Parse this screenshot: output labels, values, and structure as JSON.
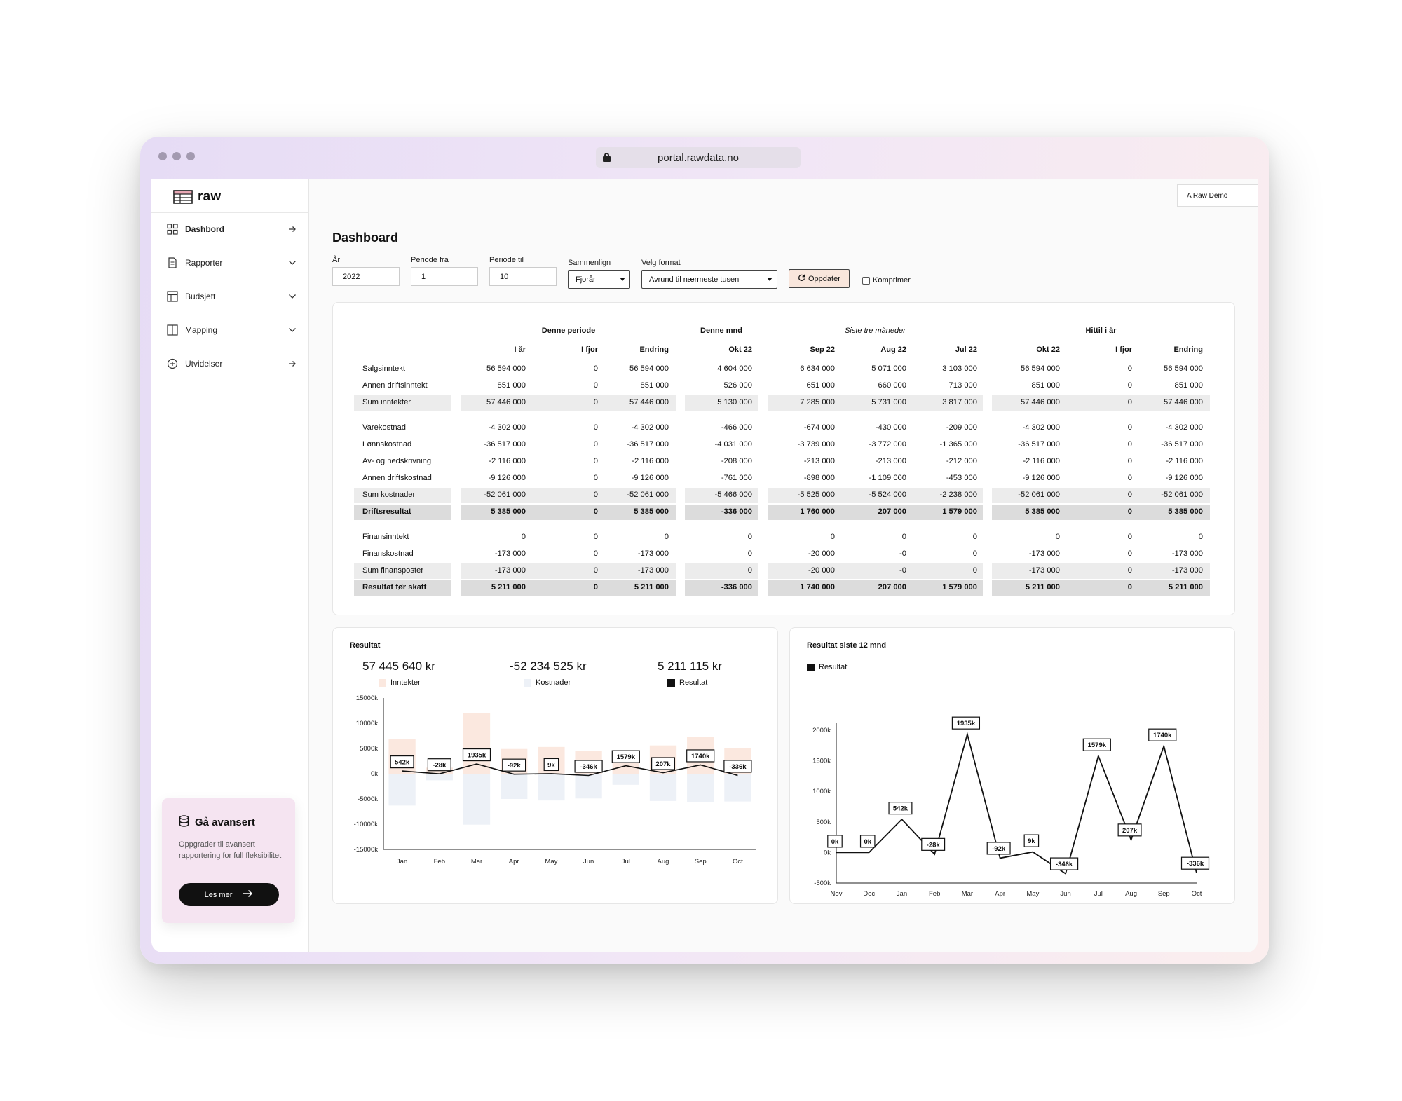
{
  "browser": {
    "url": "portal.rawdata.no"
  },
  "sidebar": {
    "logo": "raw",
    "items": [
      {
        "label": "Dashbord",
        "arrow": "right",
        "active": true
      },
      {
        "label": "Rapporter",
        "arrow": "down"
      },
      {
        "label": "Budsjett",
        "arrow": "down"
      },
      {
        "label": "Mapping",
        "arrow": "down"
      },
      {
        "label": "Utvidelser",
        "arrow": "right"
      }
    ],
    "promo": {
      "title": "Gå avansert",
      "text": "Oppgrader til avansert rapportering for full fleksibilitet",
      "button": "Les mer"
    }
  },
  "header": {
    "user": "A Raw Demo"
  },
  "page": {
    "title": "Dashboard"
  },
  "filters": {
    "year_label": "År",
    "year": "2022",
    "from_label": "Periode fra",
    "from": "1",
    "to_label": "Periode til",
    "to": "10",
    "compare_label": "Sammenlign",
    "compare": "Fjorår",
    "format_label": "Velg format",
    "format": "Avrund til nærmeste tusen",
    "update": "Oppdater",
    "compress": "Komprimer"
  },
  "table": {
    "groups": [
      "Denne periode",
      "Denne mnd",
      "Siste tre måneder",
      "Hittil i år"
    ],
    "columns": [
      "I år",
      "I fjor",
      "Endring",
      "Okt 22",
      "Sep 22",
      "Aug 22",
      "Jul 22",
      "Okt 22",
      "I fjor",
      "Endring"
    ],
    "rows": [
      {
        "label": "Salgsinntekt",
        "values": [
          "56 594 000",
          "0",
          "56 594 000",
          "4 604 000",
          "6 634 000",
          "5 071 000",
          "3 103 000",
          "56 594 000",
          "0",
          "56 594 000"
        ]
      },
      {
        "label": "Annen driftsinntekt",
        "values": [
          "851 000",
          "0",
          "851 000",
          "526 000",
          "651 000",
          "660 000",
          "713 000",
          "851 000",
          "0",
          "851 000"
        ]
      },
      {
        "label": "Sum inntekter",
        "values": [
          "57 446 000",
          "0",
          "57 446 000",
          "5 130 000",
          "7 285 000",
          "5 731 000",
          "3 817 000",
          "57 446 000",
          "0",
          "57 446 000"
        ]
      },
      {
        "label": "Varekostnad",
        "values": [
          "-4 302 000",
          "0",
          "-4 302 000",
          "-466 000",
          "-674 000",
          "-430 000",
          "-209 000",
          "-4 302 000",
          "0",
          "-4 302 000"
        ]
      },
      {
        "label": "Lønnskostnad",
        "values": [
          "-36 517 000",
          "0",
          "-36 517 000",
          "-4 031 000",
          "-3 739 000",
          "-3 772 000",
          "-1 365 000",
          "-36 517 000",
          "0",
          "-36 517 000"
        ]
      },
      {
        "label": "Av- og nedskrivning",
        "values": [
          "-2 116 000",
          "0",
          "-2 116 000",
          "-208 000",
          "-213 000",
          "-213 000",
          "-212 000",
          "-2 116 000",
          "0",
          "-2 116 000"
        ]
      },
      {
        "label": "Annen driftskostnad",
        "values": [
          "-9 126 000",
          "0",
          "-9 126 000",
          "-761 000",
          "-898 000",
          "-1 109 000",
          "-453 000",
          "-9 126 000",
          "0",
          "-9 126 000"
        ]
      },
      {
        "label": "Sum kostnader",
        "values": [
          "-52 061 000",
          "0",
          "-52 061 000",
          "-5 466 000",
          "-5 525 000",
          "-5 524 000",
          "-2 238 000",
          "-52 061 000",
          "0",
          "-52 061 000"
        ]
      },
      {
        "label": "Driftsresultat",
        "values": [
          "5 385 000",
          "0",
          "5 385 000",
          "-336 000",
          "1 760 000",
          "207 000",
          "1 579 000",
          "5 385 000",
          "0",
          "5 385 000"
        ]
      },
      {
        "label": "Finansinntekt",
        "values": [
          "0",
          "0",
          "0",
          "0",
          "0",
          "0",
          "0",
          "0",
          "0",
          "0"
        ]
      },
      {
        "label": "Finanskostnad",
        "values": [
          "-173 000",
          "0",
          "-173 000",
          "0",
          "-20 000",
          "-0",
          "0",
          "-173 000",
          "0",
          "-173 000"
        ]
      },
      {
        "label": "Sum finansposter",
        "values": [
          "-173 000",
          "0",
          "-173 000",
          "0",
          "-20 000",
          "-0",
          "0",
          "-173 000",
          "0",
          "-173 000"
        ]
      },
      {
        "label": "Resultat før skatt",
        "values": [
          "5 211 000",
          "0",
          "5 211 000",
          "-336 000",
          "1 740 000",
          "207 000",
          "1 579 000",
          "5 211 000",
          "0",
          "5 211 000"
        ]
      }
    ]
  },
  "kpis": {
    "income": "57 445 640 kr",
    "income_label": "Inntekter",
    "costs": "-52 234 525 kr",
    "costs_label": "Kostnader",
    "result": "5 211 115 kr",
    "result_label": "Resultat"
  },
  "colors": {
    "income": "#fbe8df",
    "costs": "#edf1f7",
    "result": "#111111"
  },
  "chart_data": [
    {
      "type": "bar",
      "title": "Resultat",
      "categories": [
        "Jan",
        "Feb",
        "Mar",
        "Apr",
        "May",
        "Jun",
        "Jul",
        "Aug",
        "Sep",
        "Oct"
      ],
      "ylim": [
        -15000,
        15000
      ],
      "yticks": [
        15000,
        10000,
        5000,
        0,
        -5000,
        -10000,
        -15000
      ],
      "ytick_labels": [
        "15000k",
        "10000k",
        "5000k",
        "0k",
        "-5000k",
        "-10000k",
        "-15000k"
      ],
      "series": [
        {
          "name": "Inntekter",
          "type": "bar",
          "values": [
            6800,
            1200,
            12000,
            4900,
            5300,
            4500,
            3800,
            5600,
            7300,
            5100
          ]
        },
        {
          "name": "Kostnader",
          "type": "bar",
          "values": [
            -6300,
            -1300,
            -10100,
            -5000,
            -5300,
            -4900,
            -2200,
            -5400,
            -5600,
            -5500
          ]
        },
        {
          "name": "Resultat",
          "type": "line",
          "values": [
            542,
            -28,
            1935,
            -92,
            9,
            -346,
            1579,
            207,
            1740,
            -336
          ],
          "labels": [
            "542k",
            "-28k",
            "1935k",
            "-92k",
            "9k",
            "-346k",
            "1579k",
            "207k",
            "1740k",
            "-336k"
          ]
        }
      ]
    },
    {
      "type": "line",
      "title": "Resultat siste 12 mnd",
      "categories": [
        "Nov",
        "Dec",
        "Jan",
        "Feb",
        "Mar",
        "Apr",
        "May",
        "Jun",
        "Jul",
        "Aug",
        "Sep",
        "Oct"
      ],
      "ylim": [
        -500,
        2000
      ],
      "yticks": [
        2000,
        1500,
        1000,
        500,
        0,
        -500
      ],
      "ytick_labels": [
        "2000k",
        "1500k",
        "1000k",
        "500k",
        "0k",
        "-500k"
      ],
      "series": [
        {
          "name": "Resultat",
          "values": [
            0,
            0,
            542,
            -28,
            1935,
            -92,
            9,
            -346,
            1579,
            207,
            1740,
            -336
          ],
          "labels": [
            "0k",
            "0k",
            "542k",
            "-28k",
            "1935k",
            "-92k",
            "9k",
            "-346k",
            "1579k",
            "207k",
            "1740k",
            "-336k"
          ]
        }
      ]
    }
  ]
}
